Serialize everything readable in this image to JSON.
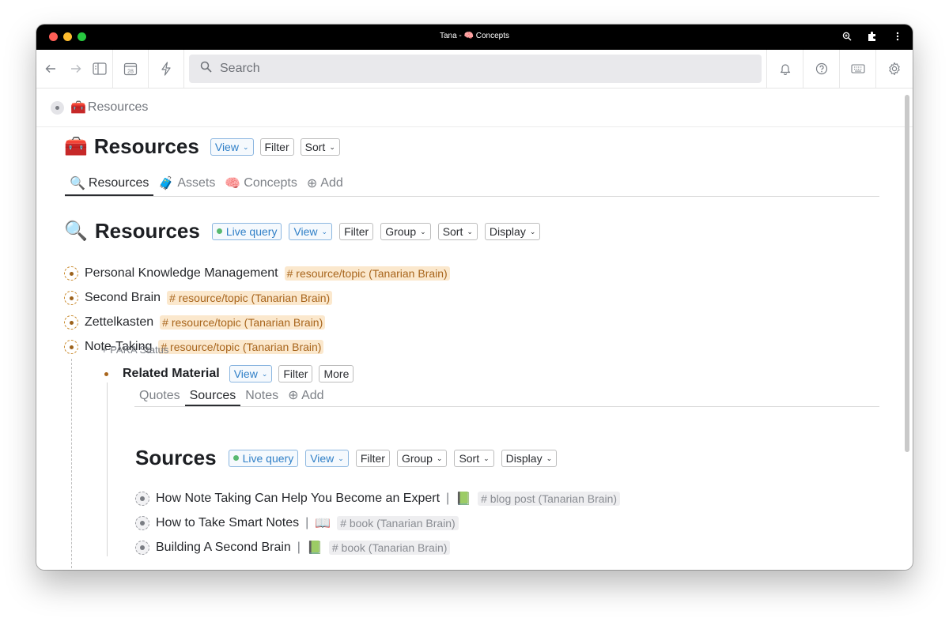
{
  "window": {
    "title": "Tana - 🧠 Concepts"
  },
  "toolbar": {
    "search_placeholder": "Search",
    "calendar_day": "28"
  },
  "breadcrumb": {
    "emoji": "🧰",
    "label": "Resources"
  },
  "page": {
    "emoji": "🧰",
    "title": "Resources",
    "buttons": {
      "view": "View",
      "filter": "Filter",
      "sort": "Sort"
    },
    "tabs": [
      {
        "emoji": "🔍",
        "label": "Resources"
      },
      {
        "emoji": "🧳",
        "label": "Assets"
      },
      {
        "emoji": "🧠",
        "label": "Concepts"
      },
      {
        "emoji": "⊕",
        "label": "Add"
      }
    ]
  },
  "query": {
    "emoji": "🔍",
    "title": "Resources",
    "live_label": "Live query",
    "buttons": {
      "view": "View",
      "filter": "Filter",
      "group": "Group",
      "sort": "Sort",
      "display": "Display"
    }
  },
  "nodes": [
    {
      "label": "Personal Knowledge Management",
      "tag": "# resource/topic (Tanarian Brain)"
    },
    {
      "label": "Second Brain",
      "tag": "# resource/topic (Tanarian Brain)"
    },
    {
      "label": "Zettelkasten",
      "tag": "# resource/topic (Tanarian Brain)"
    },
    {
      "label": "Note-Taking",
      "tag": "# resource/topic (Tanarian Brain)"
    }
  ],
  "para_status": "+ PARA Status",
  "related": {
    "title": "Related Material",
    "buttons": {
      "view": "View",
      "filter": "Filter",
      "more": "More"
    },
    "tabs": [
      {
        "label": "Quotes"
      },
      {
        "label": "Sources"
      },
      {
        "label": "Notes"
      },
      {
        "label": "⊕ Add"
      }
    ]
  },
  "sources": {
    "title": "Sources",
    "live_label": "Live query",
    "buttons": {
      "view": "View",
      "filter": "Filter",
      "group": "Group",
      "sort": "Sort",
      "display": "Display"
    },
    "items": [
      {
        "label": "How Note Taking Can Help You Become an Expert",
        "sep": "|",
        "emoji": "📗",
        "tag": "# blog post (Tanarian Brain)"
      },
      {
        "label": "How to Take Smart Notes",
        "sep": "|",
        "emoji": "📖",
        "tag": "# book (Tanarian Brain)"
      },
      {
        "label": "Building A Second Brain",
        "sep": "|",
        "emoji": "📗",
        "tag": "# book (Tanarian Brain)"
      }
    ]
  }
}
